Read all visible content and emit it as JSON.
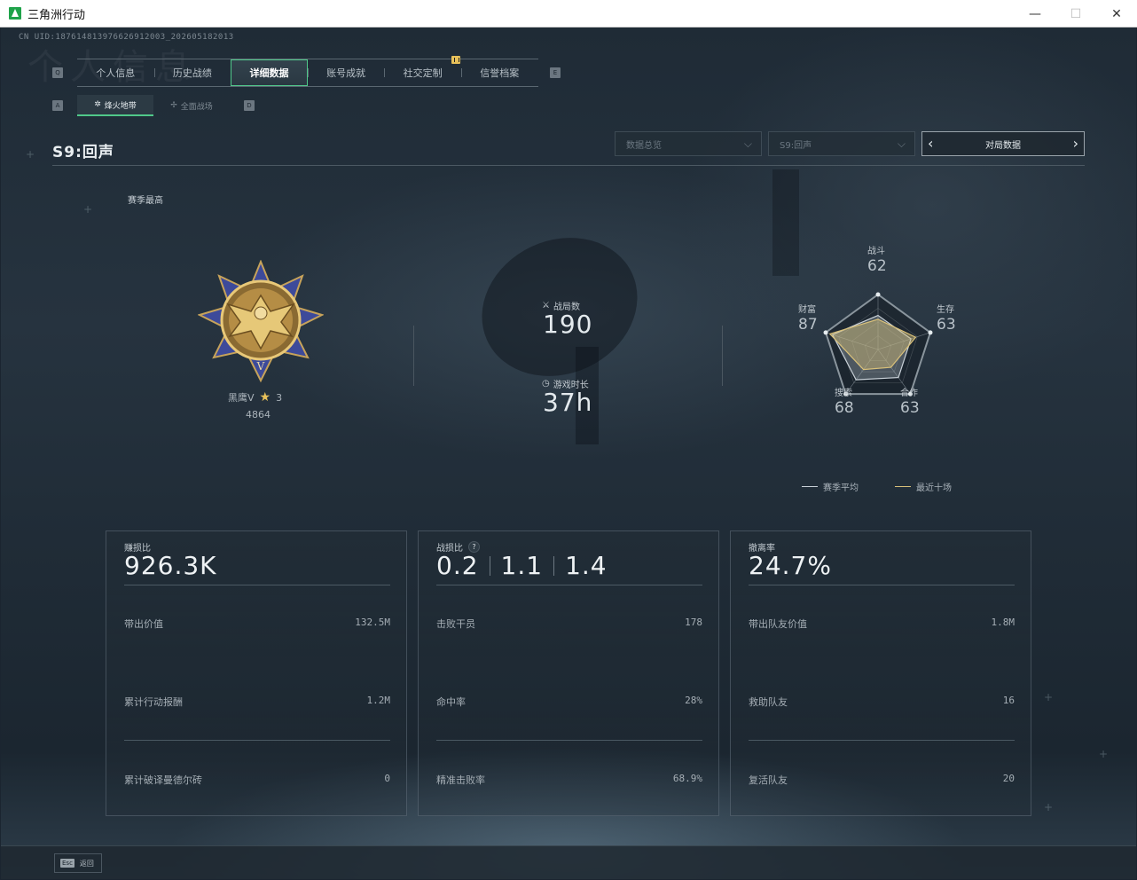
{
  "window": {
    "title": "三角洲行动",
    "minimize": "—",
    "maximize": "☐",
    "close": "✕"
  },
  "uid": "CN UID:187614813976626912003_202605182013",
  "watermark": "个人信息",
  "main_tabs": [
    "个人信息",
    "历史战绩",
    "详细数据",
    "账号成就",
    "社交定制",
    "信誉档案"
  ],
  "main_tab_active": "详细数据",
  "key_hints": {
    "left": "Q",
    "right": "E",
    "sub_left": "A",
    "sub_right": "D"
  },
  "sub_tabs": [
    {
      "label": "烽火地带",
      "icon": "flame-icon",
      "active": true
    },
    {
      "label": "全面战场",
      "icon": "battlefield-icon",
      "active": false
    }
  ],
  "season": {
    "title": "S9:回声",
    "best_label": "赛季最高"
  },
  "filters": {
    "data_overview": "数据总览",
    "season": "S9:回声",
    "match_data": "对局数据"
  },
  "rank": {
    "name": "黑鹰V",
    "stars": "3",
    "score": "4864"
  },
  "summary": {
    "matches_label": "战局数",
    "matches_value": "190",
    "playtime_label": "游戏时长",
    "playtime_value": "37h"
  },
  "radar": {
    "axes": [
      {
        "label": "战斗",
        "value": 62
      },
      {
        "label": "生存",
        "value": 63
      },
      {
        "label": "合作",
        "value": 63
      },
      {
        "label": "搜索",
        "value": 68
      },
      {
        "label": "财富",
        "value": 87
      }
    ],
    "series_avg": [
      62,
      63,
      63,
      68,
      87
    ],
    "series_recent": [
      55,
      72,
      40,
      45,
      92
    ],
    "legend_avg": "赛季平均",
    "legend_recent": "最近十场",
    "color_avg": "#c9d1d8",
    "color_recent": "#d8c07a"
  },
  "cards": [
    {
      "title": "赚损比",
      "big": [
        "926.3K"
      ],
      "help": false,
      "rows": [
        {
          "k": "带出价值",
          "v": "132.5M"
        },
        {
          "k": "累计行动报酬",
          "v": "1.2M"
        },
        {
          "k": "累计破译曼德尔砖",
          "v": "0"
        }
      ]
    },
    {
      "title": "战损比",
      "big": [
        "0.2",
        "1.1",
        "1.4"
      ],
      "help": true,
      "rows": [
        {
          "k": "击败干员",
          "v": "178"
        },
        {
          "k": "命中率",
          "v": "28%"
        },
        {
          "k": "精准击败率",
          "v": "68.9%"
        }
      ]
    },
    {
      "title": "撤离率",
      "big": [
        "24.7%"
      ],
      "help": false,
      "rows": [
        {
          "k": "带出队友价值",
          "v": "1.8M"
        },
        {
          "k": "救助队友",
          "v": "16"
        },
        {
          "k": "复活队友",
          "v": "20"
        }
      ]
    }
  ],
  "footer": {
    "esc_key": "Esc",
    "back_label": "返回"
  },
  "colors": {
    "accent": "#50c88a",
    "gold": "#e8c15a"
  }
}
